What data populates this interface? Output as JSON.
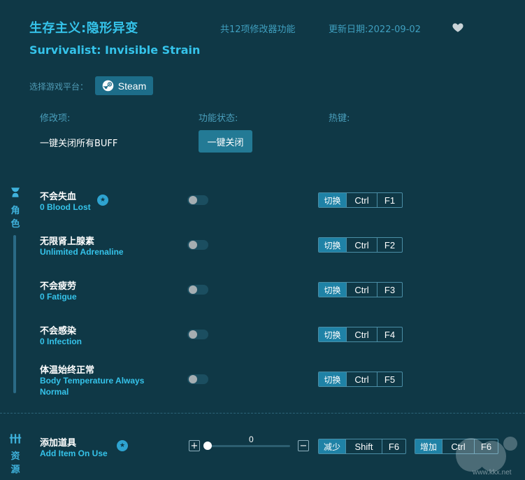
{
  "header": {
    "title_cn": "生存主义:隐形异变",
    "title_en": "Survivalist: Invisible Strain",
    "feature_count": "共12项修改器功能",
    "update_date": "更新日期:2022-09-02"
  },
  "platform": {
    "label": "选择游戏平台：",
    "steam_label": "Steam"
  },
  "columns": {
    "mod": "修改项:",
    "status": "功能状态:",
    "hotkey": "热键:"
  },
  "all_buff": {
    "label": "一键关闭所有BUFF",
    "button": "一键关闭"
  },
  "categories": {
    "role": [
      "角",
      "色"
    ],
    "resource": [
      "资",
      "源"
    ]
  },
  "items": [
    {
      "cn": "不会失血",
      "en": "0 Blood Lost",
      "star": true,
      "mode": "切换",
      "mod": "Ctrl",
      "key": "F1"
    },
    {
      "cn": "无限肾上腺素",
      "en": "Unlimited Adrenaline",
      "star": false,
      "mode": "切换",
      "mod": "Ctrl",
      "key": "F2"
    },
    {
      "cn": "不会疲劳",
      "en": "0 Fatigue",
      "star": false,
      "mode": "切换",
      "mod": "Ctrl",
      "key": "F3"
    },
    {
      "cn": "不会感染",
      "en": "0 Infection",
      "star": false,
      "mode": "切换",
      "mod": "Ctrl",
      "key": "F4"
    },
    {
      "cn": "体温始终正常",
      "en": "Body Temperature Always Normal",
      "en_line1": "Body Temperature Always",
      "en_line2": "Normal",
      "star": false,
      "mode": "切换",
      "mod": "Ctrl",
      "key": "F5"
    }
  ],
  "resource_item": {
    "cn": "添加道具",
    "en": "Add Item On Use",
    "value": "0",
    "plus": "+",
    "minus": "−",
    "decrease": {
      "mode": "减少",
      "mod": "Shift",
      "key": "F6"
    },
    "increase": {
      "mode": "增加",
      "mod": "Ctrl",
      "key": "F6"
    }
  },
  "watermark": "www.kkx.net",
  "colors": {
    "background": "#0f3846",
    "accent": "#35c3ea",
    "button": "#237a95"
  },
  "icons": {
    "heart": "heart-icon",
    "steam": "steam-icon",
    "role": "character-icon",
    "resource": "resource-icon",
    "star": "star-badge-icon"
  }
}
